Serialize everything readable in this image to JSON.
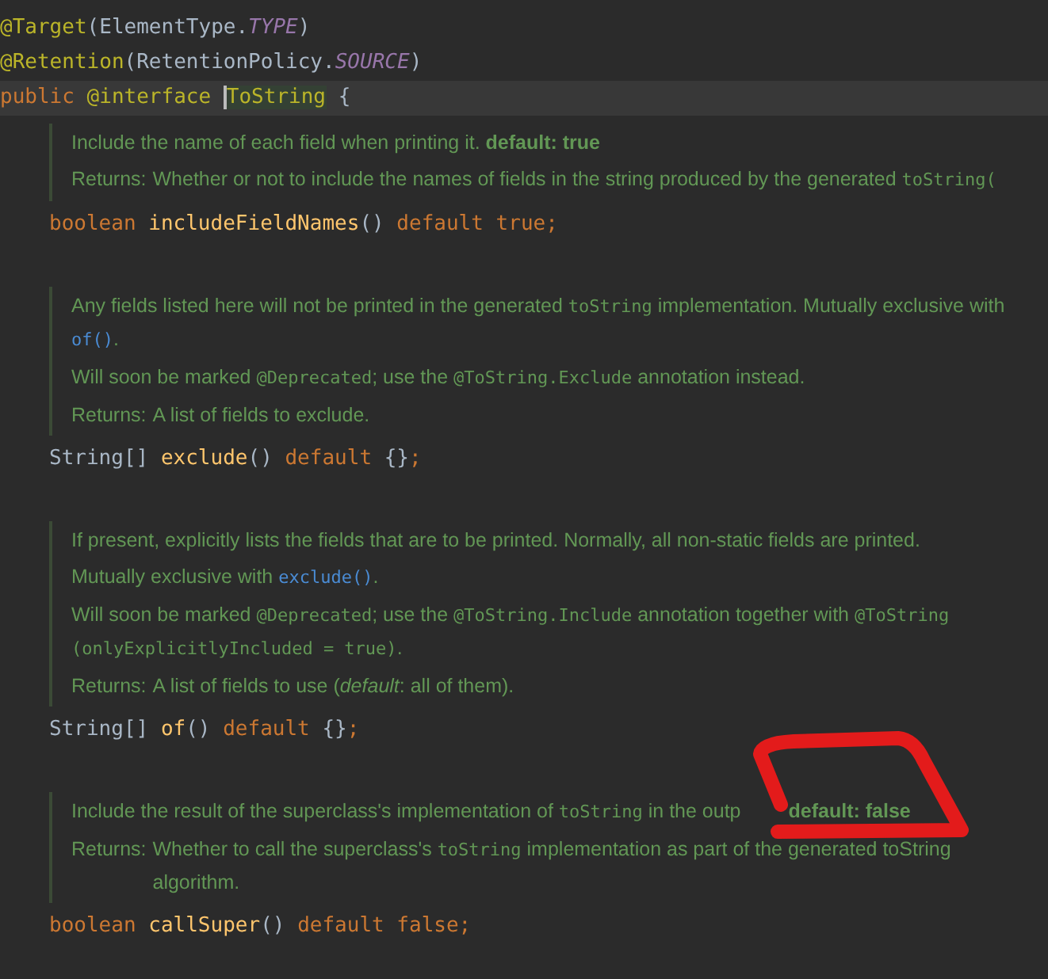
{
  "editor": {
    "blocks": [
      {
        "kind": "code",
        "indent": false,
        "current": false,
        "tokens": [
          {
            "kind": "annotation",
            "text": "@Target"
          },
          {
            "kind": "plain",
            "text": "(ElementType."
          },
          {
            "kind": "constant",
            "text": "TYPE"
          },
          {
            "kind": "plain",
            "text": ")"
          }
        ]
      },
      {
        "kind": "code",
        "indent": false,
        "current": false,
        "tokens": [
          {
            "kind": "annotation",
            "text": "@Retention"
          },
          {
            "kind": "plain",
            "text": "(RetentionPolicy."
          },
          {
            "kind": "constant",
            "text": "SOURCE"
          },
          {
            "kind": "plain",
            "text": ")"
          }
        ]
      },
      {
        "kind": "code",
        "indent": false,
        "current": true,
        "tokens": [
          {
            "kind": "keyword",
            "text": "public "
          },
          {
            "kind": "annotation",
            "text": "@interface "
          },
          {
            "kind": "highlight",
            "text": "ToString"
          },
          {
            "kind": "plain",
            "text": " {"
          }
        ]
      },
      {
        "kind": "doc",
        "paragraphs": [
          {
            "segments": [
              {
                "kind": "text",
                "text": "Include the name of each field when printing it. "
              },
              {
                "kind": "bold",
                "text": "default: true"
              }
            ]
          },
          {
            "label": "Returns:",
            "segments": [
              {
                "kind": "text",
                "text": "Whether or not to include the names of fields in the string produced by the generated "
              },
              {
                "kind": "code",
                "text": "toString("
              }
            ]
          }
        ]
      },
      {
        "kind": "code",
        "indent": true,
        "current": false,
        "tokens": [
          {
            "kind": "keyword",
            "text": "boolean "
          },
          {
            "kind": "method",
            "text": "includeFieldNames"
          },
          {
            "kind": "plain",
            "text": "() "
          },
          {
            "kind": "keyword",
            "text": "default true;"
          }
        ]
      },
      {
        "kind": "doc",
        "paragraphs": [
          {
            "segments": [
              {
                "kind": "text",
                "text": "Any fields listed here will not be printed in the generated "
              },
              {
                "kind": "code",
                "text": "toString"
              },
              {
                "kind": "text",
                "text": " implementation. Mutually exclusive with"
              },
              {
                "kind": "break"
              },
              {
                "kind": "link",
                "text": "of()"
              },
              {
                "kind": "text",
                "text": "."
              }
            ]
          },
          {
            "segments": [
              {
                "kind": "text",
                "text": "Will soon be marked "
              },
              {
                "kind": "code",
                "text": "@Deprecated"
              },
              {
                "kind": "text",
                "text": "; use the "
              },
              {
                "kind": "code",
                "text": "@ToString.Exclude"
              },
              {
                "kind": "text",
                "text": " annotation instead."
              }
            ]
          },
          {
            "label": "Returns:",
            "segments": [
              {
                "kind": "text",
                "text": "A list of fields to exclude."
              }
            ]
          }
        ]
      },
      {
        "kind": "code",
        "indent": true,
        "current": false,
        "tokens": [
          {
            "kind": "plain",
            "text": "String[] "
          },
          {
            "kind": "method",
            "text": "exclude"
          },
          {
            "kind": "plain",
            "text": "() "
          },
          {
            "kind": "keyword",
            "text": "default "
          },
          {
            "kind": "plain",
            "text": "{}"
          },
          {
            "kind": "keyword",
            "text": ";"
          }
        ]
      },
      {
        "kind": "doc",
        "paragraphs": [
          {
            "segments": [
              {
                "kind": "text",
                "text": "If present, explicitly lists the fields that are to be printed. Normally, all non-static fields are printed."
              }
            ]
          },
          {
            "segments": [
              {
                "kind": "text",
                "text": "Mutually exclusive with "
              },
              {
                "kind": "link",
                "text": "exclude()"
              },
              {
                "kind": "text",
                "text": "."
              }
            ]
          },
          {
            "segments": [
              {
                "kind": "text",
                "text": "Will soon be marked "
              },
              {
                "kind": "code",
                "text": "@Deprecated"
              },
              {
                "kind": "text",
                "text": "; use the "
              },
              {
                "kind": "code",
                "text": "@ToString.Include"
              },
              {
                "kind": "text",
                "text": " annotation together with "
              },
              {
                "kind": "code",
                "text": "@ToString"
              },
              {
                "kind": "break"
              },
              {
                "kind": "code",
                "text": "(onlyExplicitlyIncluded = true)"
              },
              {
                "kind": "text",
                "text": "."
              }
            ]
          },
          {
            "label": "Returns:",
            "segments": [
              {
                "kind": "text",
                "text": "A list of fields to use ("
              },
              {
                "kind": "italic",
                "text": "default"
              },
              {
                "kind": "text",
                "text": ": all of them)."
              }
            ]
          }
        ]
      },
      {
        "kind": "code",
        "indent": true,
        "current": false,
        "tokens": [
          {
            "kind": "plain",
            "text": "String[] "
          },
          {
            "kind": "method",
            "text": "of"
          },
          {
            "kind": "plain",
            "text": "() "
          },
          {
            "kind": "keyword",
            "text": "default "
          },
          {
            "kind": "plain",
            "text": "{}"
          },
          {
            "kind": "keyword",
            "text": ";"
          }
        ]
      },
      {
        "kind": "doc",
        "paragraphs": [
          {
            "segments": [
              {
                "kind": "text",
                "text": "Include the result of the superclass's implementation of "
              },
              {
                "kind": "code",
                "text": "toString"
              },
              {
                "kind": "text",
                "text": " in the outp"
              },
              {
                "kind": "gap"
              },
              {
                "kind": "bold",
                "text": "default: false"
              }
            ]
          },
          {
            "label": "Returns:",
            "segments": [
              {
                "kind": "text",
                "text": "Whether to call the superclass's "
              },
              {
                "kind": "code",
                "text": "toString"
              },
              {
                "kind": "text",
                "text": " implementation as part of the generated toString"
              },
              {
                "kind": "break"
              },
              {
                "kind": "text",
                "text": "algorithm."
              }
            ]
          }
        ]
      },
      {
        "kind": "code",
        "indent": true,
        "current": false,
        "tokens": [
          {
            "kind": "keyword",
            "text": "boolean "
          },
          {
            "kind": "method",
            "text": "callSuper"
          },
          {
            "kind": "plain",
            "text": "() "
          },
          {
            "kind": "keyword",
            "text": "default false;"
          }
        ]
      }
    ]
  },
  "markup": {
    "kind": "scribble"
  }
}
